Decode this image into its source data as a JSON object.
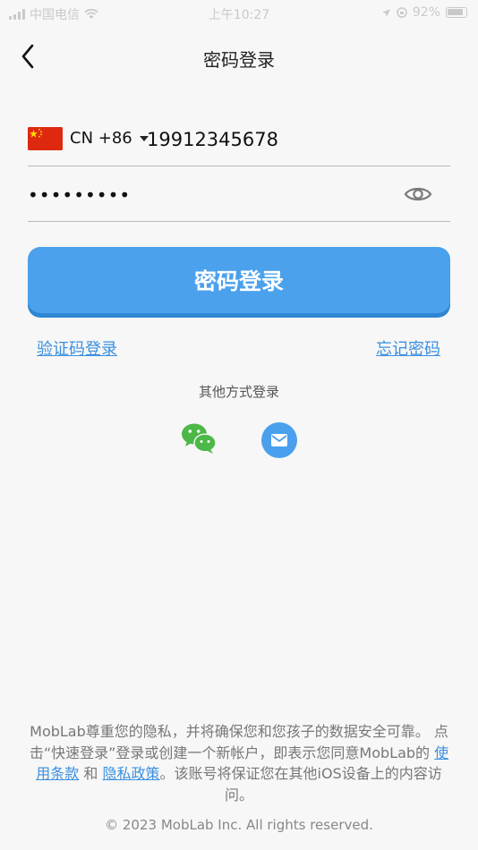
{
  "status_bar": {
    "carrier": "中国电信",
    "time": "上午10:27",
    "battery": "92%"
  },
  "nav": {
    "title": "密码登录"
  },
  "form": {
    "country_code": "CN +86",
    "phone_value": "19912345678",
    "password_value": "•••••••••"
  },
  "login_button_label": "密码登录",
  "links": {
    "sms_login": "验证码登录",
    "forgot_password": "忘记密码"
  },
  "other_methods_label": "其他方式登录",
  "social_icons": [
    "wechat-icon",
    "email-icon"
  ],
  "footer": {
    "disclaimer_part1": "MobLab尊重您的隐私，并将确保您和您孩子的数据安全可靠。 点击“快速登录”登录或创建一个新帐户，即表示您同意MobLab的 ",
    "terms_link": "使用条款",
    "and_text": " 和 ",
    "privacy_link": "隐私政策",
    "disclaimer_part2": "。该账号将保证您在其他iOS设备上的内容访问。",
    "copyright": "© 2023 MobLab Inc. All rights reserved."
  },
  "colors": {
    "accent": "#4ba1ec",
    "link": "#3a8fe0",
    "wechat_green": "#4cb848",
    "background": "#f7f7f7"
  }
}
